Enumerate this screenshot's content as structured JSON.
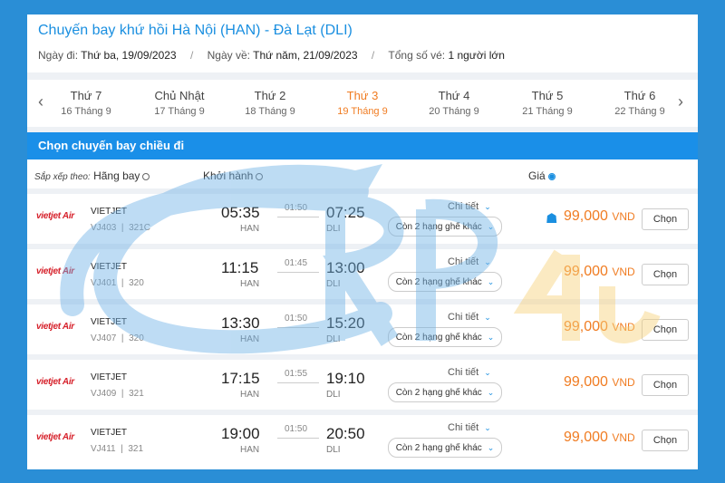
{
  "title": "Chuyến bay khứ hồi Hà Nội (HAN) - Đà Lạt (DLI)",
  "info": {
    "depart_label": "Ngày đi:",
    "depart_value": "Thứ ba, 19/09/2023",
    "return_label": "Ngày về:",
    "return_value": "Thứ năm, 21/09/2023",
    "tickets_label": "Tổng số vé:",
    "tickets_value": "1 người lớn"
  },
  "days": [
    {
      "name": "Thứ 7",
      "date": "16 Tháng 9"
    },
    {
      "name": "Chủ Nhật",
      "date": "17 Tháng 9"
    },
    {
      "name": "Thứ 2",
      "date": "18 Tháng 9"
    },
    {
      "name": "Thứ 3",
      "date": "19 Tháng 9"
    },
    {
      "name": "Thứ 4",
      "date": "20 Tháng 9"
    },
    {
      "name": "Thứ 5",
      "date": "21 Tháng 9"
    },
    {
      "name": "Thứ 6",
      "date": "22 Tháng 9"
    }
  ],
  "active_day_index": 3,
  "section_title": "Chọn chuyến bay chiều đi",
  "sort": {
    "label": "Sắp xếp theo:",
    "airline": "Hãng bay",
    "departure": "Khởi hành",
    "price": "Giá"
  },
  "flights": [
    {
      "logo": "vietjet Air",
      "airline": "VIETJET",
      "code": "VJ403",
      "aircraft": "321C",
      "dep_time": "05:35",
      "dep_code": "HAN",
      "duration": "01:50",
      "arr_time": "07:25",
      "arr_code": "DLI",
      "detail": "Chi tiết",
      "seats": "Còn 2 hạng ghế khác",
      "price": "99,000",
      "currency": "VND",
      "select": "Chọn",
      "badge": true
    },
    {
      "logo": "vietjet Air",
      "airline": "VIETJET",
      "code": "VJ401",
      "aircraft": "320",
      "dep_time": "11:15",
      "dep_code": "HAN",
      "duration": "01:45",
      "arr_time": "13:00",
      "arr_code": "DLI",
      "detail": "Chi tiết",
      "seats": "Còn 2 hạng ghế khác",
      "price": "99,000",
      "currency": "VND",
      "select": "Chọn",
      "badge": false
    },
    {
      "logo": "vietjet Air",
      "airline": "VIETJET",
      "code": "VJ407",
      "aircraft": "320",
      "dep_time": "13:30",
      "dep_code": "HAN",
      "duration": "01:50",
      "arr_time": "15:20",
      "arr_code": "DLI",
      "detail": "Chi tiết",
      "seats": "Còn 2 hạng ghế khác",
      "price": "99,000",
      "currency": "VND",
      "select": "Chọn",
      "badge": false
    },
    {
      "logo": "vietjet Air",
      "airline": "VIETJET",
      "code": "VJ409",
      "aircraft": "321",
      "dep_time": "17:15",
      "dep_code": "HAN",
      "duration": "01:55",
      "arr_time": "19:10",
      "arr_code": "DLI",
      "detail": "Chi tiết",
      "seats": "Còn 2 hạng ghế khác",
      "price": "99,000",
      "currency": "VND",
      "select": "Chọn",
      "badge": false
    },
    {
      "logo": "vietjet Air",
      "airline": "VIETJET",
      "code": "VJ411",
      "aircraft": "321",
      "dep_time": "19:00",
      "dep_code": "HAN",
      "duration": "01:50",
      "arr_time": "20:50",
      "arr_code": "DLI",
      "detail": "Chi tiết",
      "seats": "Còn 2 hạng ghế khác",
      "price": "99,000",
      "currency": "VND",
      "select": "Chọn",
      "badge": false
    }
  ],
  "colors": {
    "accent": "#1a8fe8",
    "price": "#f07c22",
    "brand": "#d6202a",
    "frame": "#2a8ed6"
  }
}
